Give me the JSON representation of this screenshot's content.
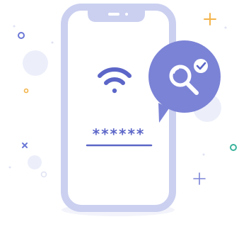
{
  "illustration": {
    "password_mask": "******"
  },
  "icons": {
    "wifi": "wifi-icon",
    "magnifier": "magnifier-icon",
    "check": "check-icon"
  },
  "colors": {
    "phone_fill": "#ffffff",
    "phone_stroke": "#cbd0f0",
    "accent": "#5c66c8",
    "speech_bubble": "#7b83d6",
    "soft_circle": "#eceffa",
    "decor_orange": "#f3b44a",
    "decor_blue": "#6c78d6",
    "decor_teal": "#3bb39c"
  }
}
